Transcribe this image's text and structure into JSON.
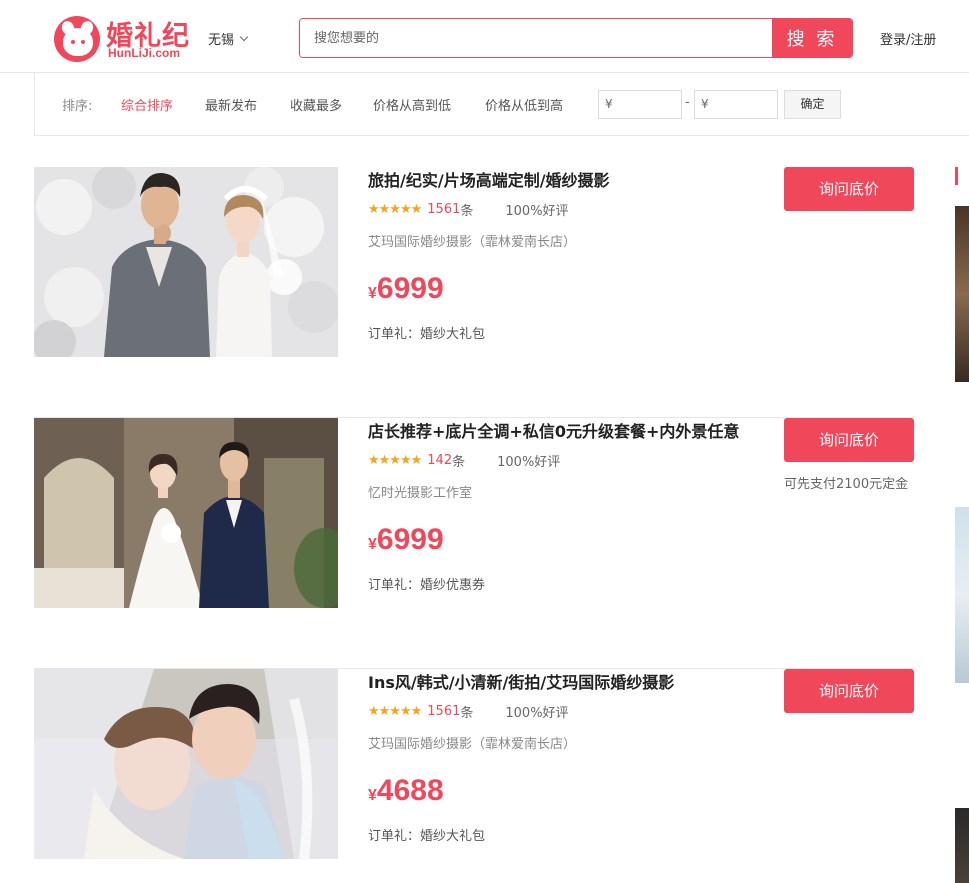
{
  "header": {
    "logo_cn": "婚礼纪",
    "logo_en": "HunLiJi.com",
    "city": "无锡",
    "search_placeholder": "搜您想要的",
    "search_button": "搜 索",
    "login": "登录/注册"
  },
  "sortbar": {
    "label": "排序:",
    "options": [
      "综合排序",
      "最新发布",
      "收藏最多",
      "价格从高到低",
      "价格从低到高"
    ],
    "active_index": 0,
    "price_min_placeholder": "¥",
    "price_max_placeholder": "¥",
    "dash": "-",
    "confirm": "确定"
  },
  "listings": [
    {
      "title": "旅拍/纪实/片场高端定制/婚纱摄影",
      "stars": "★★★★★",
      "rating": 5,
      "review_count": "1561",
      "review_unit": "条",
      "good_rate": "100%好评",
      "shop": "艾玛国际婚纱摄影（霏林爱南长店）",
      "currency": "¥",
      "price": "6999",
      "gift": "订单礼：婚纱大礼包",
      "ask_button": "询问底价",
      "deposit_note": ""
    },
    {
      "title": "店长推荐+底片全调+私信0元升级套餐+内外景任意",
      "stars": "★★★★★",
      "rating": 5,
      "review_count": "142",
      "review_unit": "条",
      "good_rate": "100%好评",
      "shop": "忆时光摄影工作室",
      "currency": "¥",
      "price": "6999",
      "gift": "订单礼：婚纱优惠券",
      "ask_button": "询问底价",
      "deposit_note": "可先支付2100元定金"
    },
    {
      "title": "Ins风/韩式/小清新/街拍/艾玛国际婚纱摄影",
      "stars": "★★★★★",
      "rating": 5,
      "review_count": "1561",
      "review_unit": "条",
      "good_rate": "100%好评",
      "shop": "艾玛国际婚纱摄影（霏林爱南长店）",
      "currency": "¥",
      "price": "4688",
      "gift": "订单礼：婚纱大礼包",
      "ask_button": "询问底价",
      "deposit_note": ""
    }
  ],
  "colors": {
    "accent": "#f0475b",
    "star": "#f7a31c"
  }
}
